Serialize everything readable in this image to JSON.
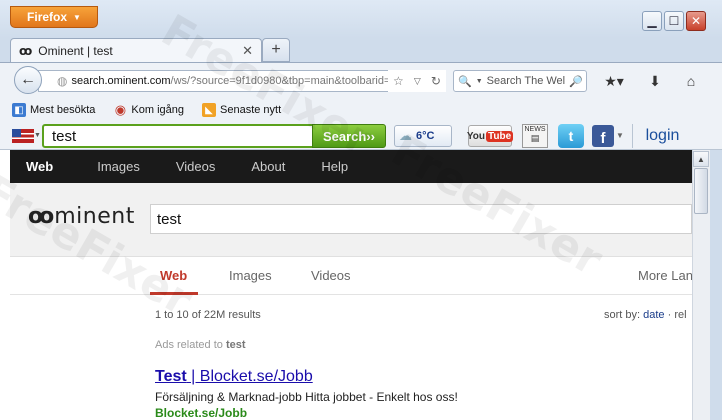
{
  "browser": {
    "menu_button": "Firefox",
    "tab_title": "Ominent | test",
    "url_host": "search.ominent.com",
    "url_path": "/ws/?source=9f1d0980&tbp=main&toolbarid=",
    "search_placeholder": "Search The Wel"
  },
  "bookmarks": [
    {
      "label": "Mest besökta"
    },
    {
      "label": "Kom igång"
    },
    {
      "label": "Senaste nytt"
    }
  ],
  "toolbar": {
    "query": "test",
    "search_button": "Search››",
    "weather_temp": "6°C",
    "youtube_you": "You",
    "youtube_tube": "Tube",
    "news_label": "NEWS",
    "login_label": "login"
  },
  "site_nav": [
    "Web",
    "Images",
    "Videos",
    "About",
    "Help"
  ],
  "site": {
    "logo_text": "minent",
    "query": "test"
  },
  "result_tabs": [
    "Web",
    "Images",
    "Videos",
    "More Lan"
  ],
  "results": {
    "count": "1 to 10 of 22M results",
    "sort_label": "sort by:",
    "sort_date": "date",
    "sort_rel": "· rel",
    "ads_prefix": "Ads related to",
    "ads_term": "test",
    "first_title_a": "Test",
    "first_title_b": " | Blocket.se/Jobb",
    "first_desc": "Försäljning & Marknad-jobb Hitta jobbet - Enkelt hos oss!",
    "first_url": "Blocket.se/Jobb"
  },
  "colors": {
    "accent_red": "#c0392b",
    "link_blue": "#1a0dab",
    "url_green": "#2a8a19",
    "search_green": "#5ba11d"
  }
}
